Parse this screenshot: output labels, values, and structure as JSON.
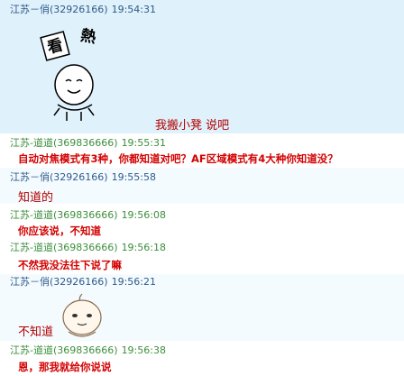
{
  "messages": [
    {
      "sender": "江苏－俏",
      "qq": "(32926166)",
      "time": "19:54:31",
      "body": "我搬小凳   说吧",
      "sticker": "watching-sticker",
      "sticker_text": [
        "看",
        "熱"
      ]
    },
    {
      "sender": "江苏-道道",
      "qq": "(369836666)",
      "time": "19:55:31",
      "body": "自动对焦模式有3种，你都知道对吧？AF区域模式有4大种你知道没？"
    },
    {
      "sender": "江苏－俏",
      "qq": "(32926166)",
      "time": "19:55:58",
      "body": "知道的"
    },
    {
      "sender": "江苏-道道",
      "qq": "(369836666)",
      "time": "19:56:08",
      "body": "你应该说，不知道"
    },
    {
      "sender": "江苏-道道",
      "qq": "(369836666)",
      "time": "19:56:18",
      "body": "不然我没法往下说了嘛"
    },
    {
      "sender": "江苏－俏",
      "qq": "(32926166)",
      "time": "19:56:21",
      "body": "不知道",
      "sticker": "onion-head-sticker"
    },
    {
      "sender": "江苏-道道",
      "qq": "(369836666)",
      "time": "19:56:38",
      "body": "恩，那我就给你说说"
    }
  ],
  "colors": {
    "highlight": "#dff1fb",
    "red": "#d30000",
    "blue": "#2f5a8a",
    "green": "#3b8f3b"
  }
}
